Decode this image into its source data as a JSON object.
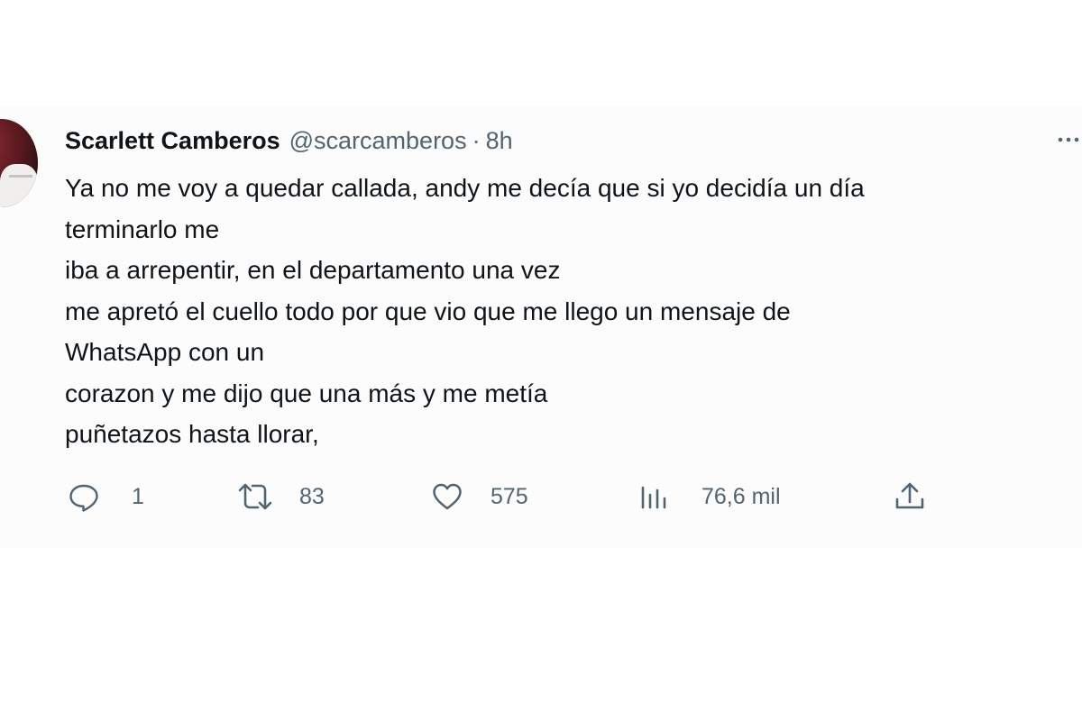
{
  "tweet": {
    "author": {
      "display_name": "Scarlett Camberos",
      "handle": "@scarcamberos",
      "separator": "·",
      "time": "8h"
    },
    "text_lines": [
      "Ya no me voy a quedar callada, andy me decía que si yo decidía un día",
      "terminarlo me",
      "iba a arrepentir, en el departamento una vez",
      "me apretó el cuello todo por que vio que me llego un mensaje de",
      "WhatsApp con un",
      "corazon y me dijo que una más y me metía",
      "puñetazos hasta llorar,"
    ],
    "actions": {
      "replies": "1",
      "retweets": "83",
      "likes": "575",
      "views": "76,6 mil"
    },
    "icons": {
      "reply": "reply-icon",
      "retweet": "retweet-icon",
      "like": "heart-icon",
      "views": "views-icon",
      "share": "share-icon",
      "more": "more-icon"
    },
    "colors": {
      "text": "#0f1419",
      "secondary": "#536471",
      "card_background": "#fcfcfc"
    }
  }
}
